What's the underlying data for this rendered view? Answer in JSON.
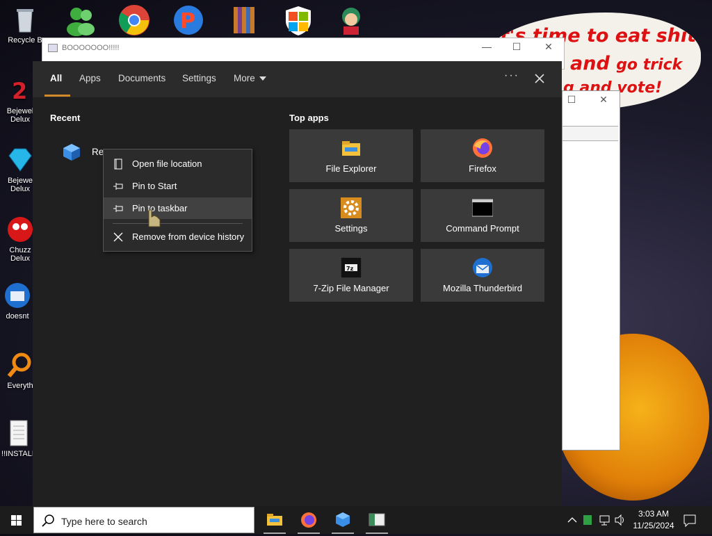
{
  "desktop": {
    "icons": [
      {
        "label": "Recycle B",
        "icon": "recycle-bin-icon"
      },
      {
        "label": "Bejewel Delux",
        "icon": "bejeweled-2-icon"
      },
      {
        "label": "Bejewe Delux",
        "icon": "bejeweled-diamond-icon"
      },
      {
        "label": "Chuzz Delux",
        "icon": "chuzzle-icon"
      },
      {
        "label": "doesnt",
        "icon": "thunderbird-icon"
      },
      {
        "label": "Everyth",
        "icon": "everything-search-icon"
      },
      {
        "label": "!!INSTALL",
        "icon": "document-icon"
      }
    ],
    "wallpaper_text": [
      "it's time to eat shit",
      "and",
      "go trick",
      "g and vote!"
    ]
  },
  "background_window": {
    "title": "BOOOOOOO!!!!!"
  },
  "search": {
    "tabs": [
      {
        "label": "All",
        "active": true
      },
      {
        "label": "Apps"
      },
      {
        "label": "Documents"
      },
      {
        "label": "Settings"
      },
      {
        "label": "More"
      }
    ],
    "more_options": "···",
    "recent_title": "Recent",
    "recent_items": [
      {
        "label": "Re",
        "icon": "blue-cube-app-icon"
      }
    ],
    "top_apps_title": "Top apps",
    "top_apps": [
      {
        "label": "File Explorer",
        "icon": "file-explorer-icon"
      },
      {
        "label": "Firefox",
        "icon": "firefox-icon"
      },
      {
        "label": "Settings",
        "icon": "settings-gear-icon"
      },
      {
        "label": "Command Prompt",
        "icon": "command-prompt-icon"
      },
      {
        "label": "7-Zip File Manager",
        "icon": "7zip-icon"
      },
      {
        "label": "Mozilla Thunderbird",
        "icon": "thunderbird-icon"
      }
    ]
  },
  "context_menu": {
    "items": [
      {
        "label": "Open file location",
        "icon": "open-file-location-icon"
      },
      {
        "label": "Pin to Start",
        "icon": "pin-icon"
      },
      {
        "label": "Pin to taskbar",
        "icon": "pin-icon",
        "hovered": true
      },
      {
        "label": "Remove from device history",
        "icon": "close-icon"
      }
    ]
  },
  "taskbar": {
    "search_placeholder": "Type here to search",
    "apps": [
      "file-explorer-icon",
      "firefox-icon",
      "blue-cube-app-icon",
      "app-window-icon"
    ],
    "time": "3:03 AM",
    "date": "11/25/2024"
  },
  "colors": {
    "panel_bg": "#202020",
    "tabbar_bg": "#2b2b2b",
    "tile_bg": "#3a3a3a",
    "accent": "#d28a2a"
  }
}
